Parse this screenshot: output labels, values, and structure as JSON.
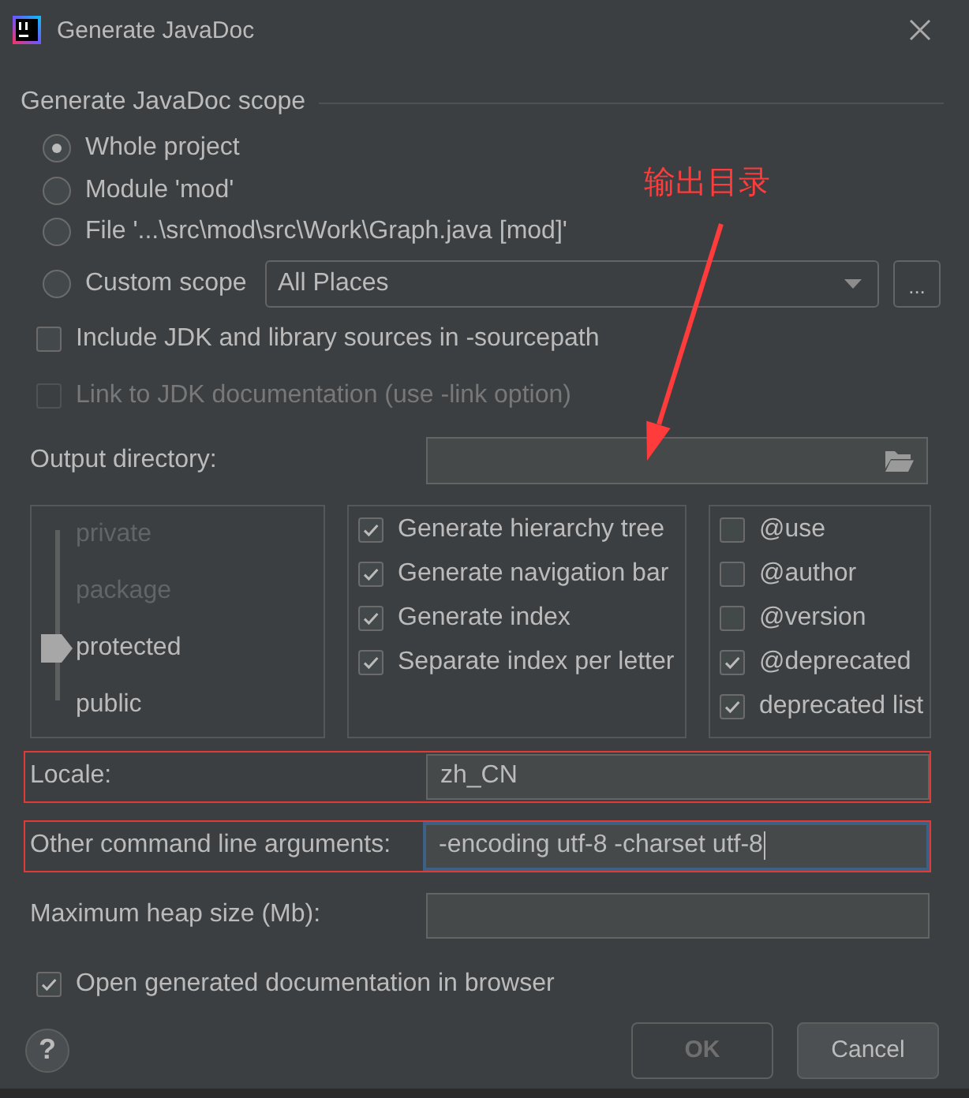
{
  "window": {
    "title": "Generate JavaDoc"
  },
  "scope": {
    "title": "Generate JavaDoc scope",
    "options": [
      {
        "label": "Whole project",
        "selected": true
      },
      {
        "label": "Module 'mod'",
        "selected": false
      },
      {
        "label": "File '...\\src\\mod\\src\\Work\\Graph.java [mod]'",
        "selected": false
      },
      {
        "label": "Custom scope",
        "selected": false,
        "dropdown": "All Places",
        "more_button": "..."
      }
    ]
  },
  "sources": [
    {
      "label": "Include JDK and library sources in -sourcepath",
      "checked": false,
      "disabled": false
    },
    {
      "label": "Link to JDK documentation (use -link option)",
      "checked": false,
      "disabled": true
    }
  ],
  "output_directory": {
    "label": "Output directory:"
  },
  "visibility": {
    "levels": [
      {
        "label": "private",
        "selected": false
      },
      {
        "label": "package",
        "selected": false
      },
      {
        "label": "protected",
        "selected": true
      },
      {
        "label": "public",
        "selected": false
      }
    ]
  },
  "generate_options": [
    {
      "label": "Generate hierarchy tree",
      "checked": true
    },
    {
      "label": "Generate navigation bar",
      "checked": true
    },
    {
      "label": "Generate index",
      "checked": true
    },
    {
      "label": "Separate index per letter",
      "checked": true
    }
  ],
  "tag_options": [
    {
      "label": "@use",
      "checked": false
    },
    {
      "label": "@author",
      "checked": false
    },
    {
      "label": "@version",
      "checked": false
    },
    {
      "label": "@deprecated",
      "checked": true
    },
    {
      "label": "deprecated list",
      "checked": true
    }
  ],
  "fields": [
    {
      "label": "Locale:",
      "value": "zh_CN",
      "focused": false,
      "highlighted": true
    },
    {
      "label": "Other command line arguments:",
      "value": "-encoding utf-8 -charset utf-8",
      "focused": true,
      "highlighted": true
    },
    {
      "label": "Maximum heap size (Mb):",
      "focused": false,
      "highlighted": false
    }
  ],
  "open_in_browser": {
    "label": "Open generated documentation in browser",
    "checked": true
  },
  "help_button": "?",
  "buttons": [
    {
      "label": "OK",
      "disabled": true
    },
    {
      "label": "Cancel",
      "disabled": false
    }
  ],
  "annotation": {
    "text": "输出目录"
  }
}
